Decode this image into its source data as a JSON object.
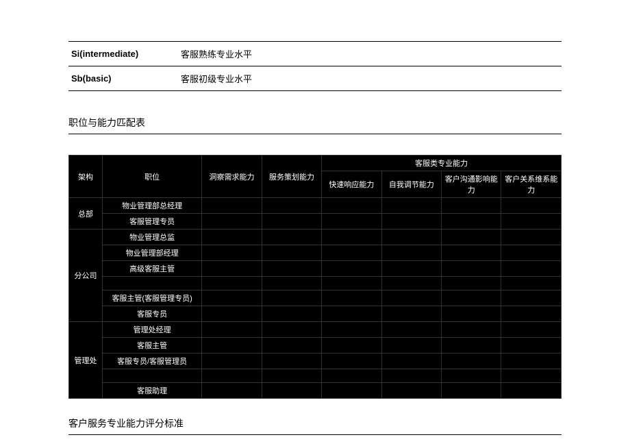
{
  "levels": [
    {
      "code": "Si(intermediate)",
      "desc": "客服熟练专业水平"
    },
    {
      "code": "Sb(basic)",
      "desc": "客服初级专业水平"
    }
  ],
  "section1_title": "职位与能力匹配表",
  "matrix": {
    "group_header": "客服类专业能力",
    "headers": {
      "org": "架构",
      "position": "职位",
      "caps": [
        "洞察需求能力",
        "服务策划能力",
        "快速响应能力",
        "自我调节能力",
        "客户沟通影响能力",
        "客户关系维系能力"
      ]
    },
    "groups": [
      {
        "org": "总部",
        "positions": [
          "物业管理部总经理",
          "客服管理专员"
        ]
      },
      {
        "org": "分公司",
        "positions": [
          "物业管理总监",
          "物业管理部经理",
          "高级客服主管",
          "",
          "客服主管(客服管理专员)",
          "客服专员"
        ]
      },
      {
        "org": "管理处",
        "positions": [
          "管理处经理",
          "客服主管",
          "客服专员/客服管理员",
          "",
          "客服助理"
        ]
      }
    ]
  },
  "section2_title": "客户服务专业能力评分标准"
}
